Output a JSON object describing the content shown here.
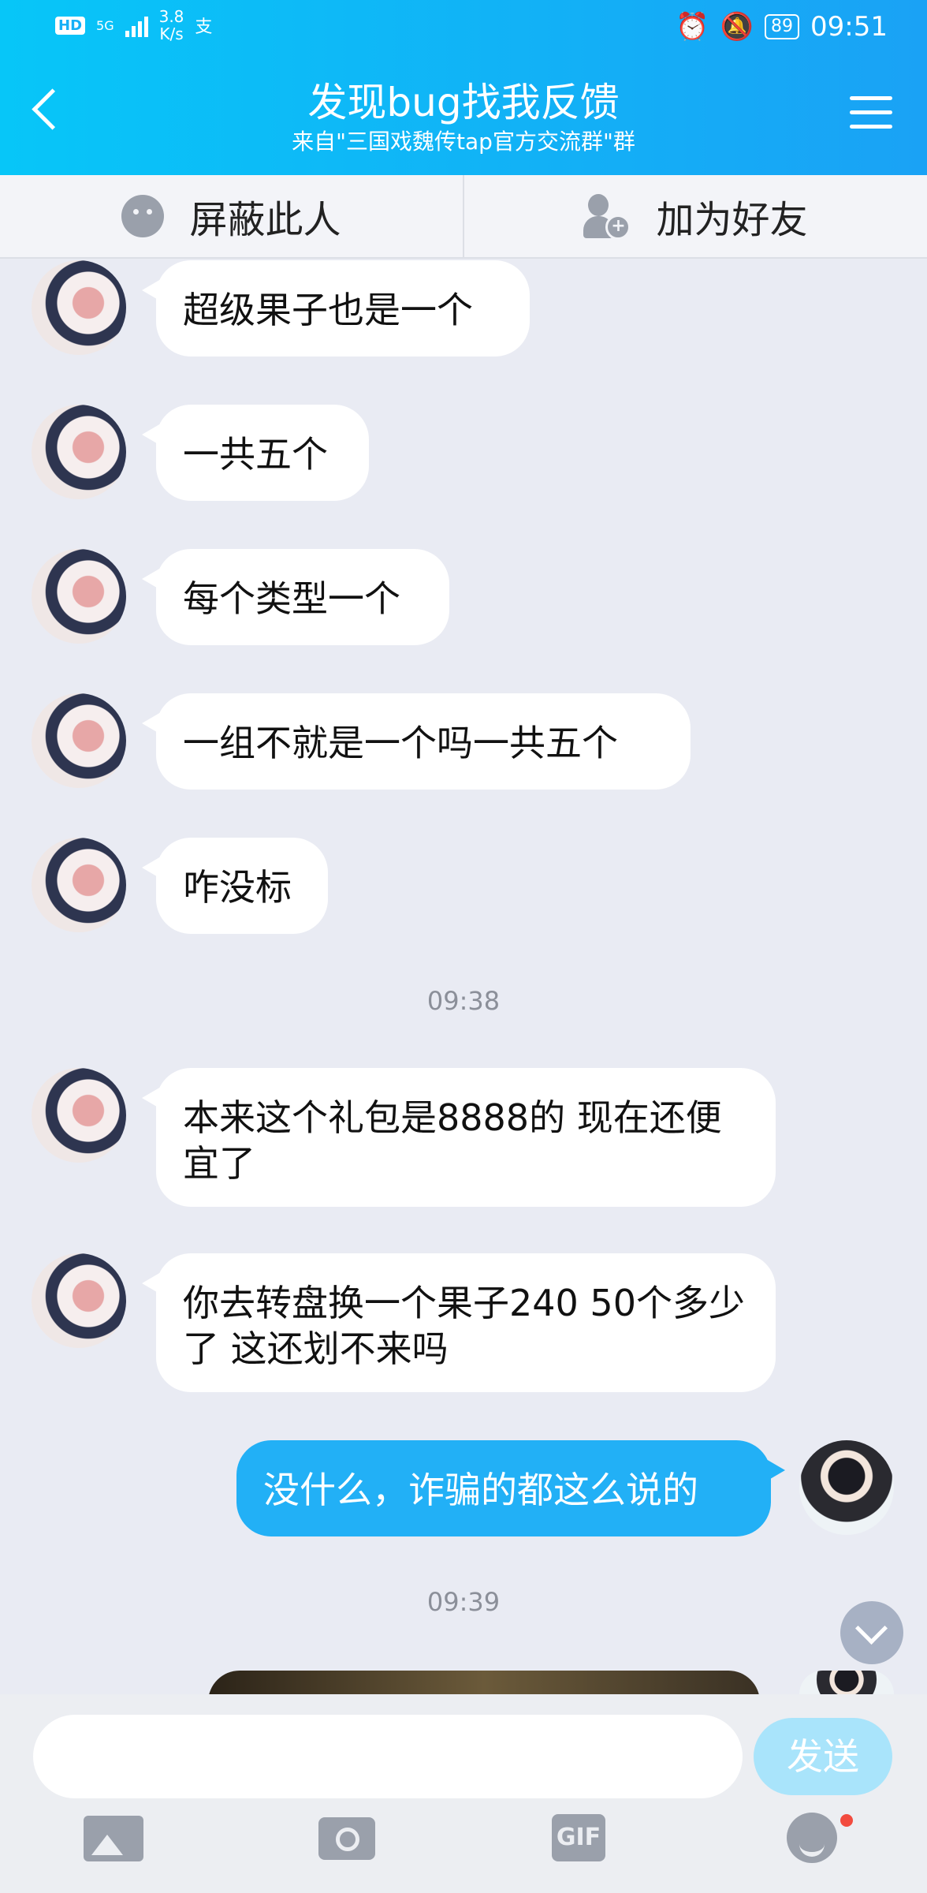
{
  "status_bar": {
    "network": "HD",
    "signal": "5G",
    "speed": "3.8\nK/s",
    "battery": "89",
    "time": "09:51"
  },
  "header": {
    "title": "发现bug找我反馈",
    "subtitle": "来自\"三国戏魏传tap官方交流群\"群"
  },
  "actions": {
    "block": "屏蔽此人",
    "add_friend": "加为好友"
  },
  "messages": [
    {
      "side": "left",
      "text": "超级果子也是一个"
    },
    {
      "side": "left",
      "text": "一共五个"
    },
    {
      "side": "left",
      "text": "每个类型一个"
    },
    {
      "side": "left",
      "text": "一组不就是一个吗一共五个"
    },
    {
      "side": "left",
      "text": "咋没标"
    },
    {
      "side": "left",
      "text": "本来这个礼包是8888的 现在还便宜了"
    },
    {
      "side": "left",
      "text": "你去转盘换一个果子240 50个多少了 这还划不来吗"
    },
    {
      "side": "right",
      "text": "没什么，诈骗的都这么说的"
    }
  ],
  "timestamps": [
    "09:38",
    "09:39"
  ],
  "input": {
    "value": "",
    "placeholder": "",
    "send_label": "发送"
  },
  "toolbar": {
    "gif_label": "GIF"
  }
}
